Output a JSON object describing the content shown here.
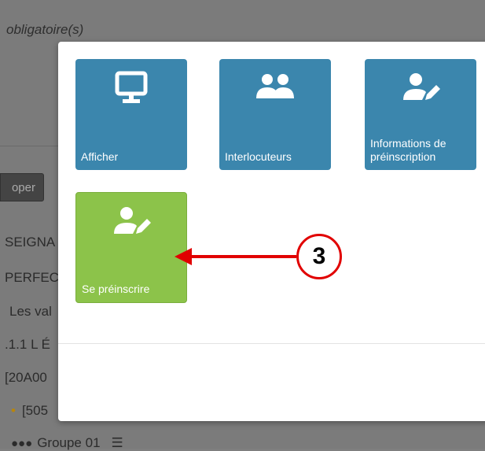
{
  "background": {
    "title": "obligatoire(s)",
    "button_label": "oper",
    "lines": [
      "SEIGNA",
      "PERFEC",
      "Les val",
      ".1.1 L É",
      "[20A00",
      "[505"
    ],
    "group_label": "Groupe 01"
  },
  "modal": {
    "tiles": [
      {
        "label": "Afficher",
        "icon": "monitor-icon",
        "color": "#3b86ad"
      },
      {
        "label": "Interlocuteurs",
        "icon": "users-icon",
        "color": "#3b86ad"
      },
      {
        "label": "Informations de préinscription",
        "icon": "user-edit-icon",
        "color": "#3b86ad"
      },
      {
        "label": "Se préinscrire",
        "icon": "user-edit-icon",
        "color": "#8cc34a"
      }
    ]
  },
  "annotation": {
    "step_number": "3",
    "color": "#e10000"
  }
}
